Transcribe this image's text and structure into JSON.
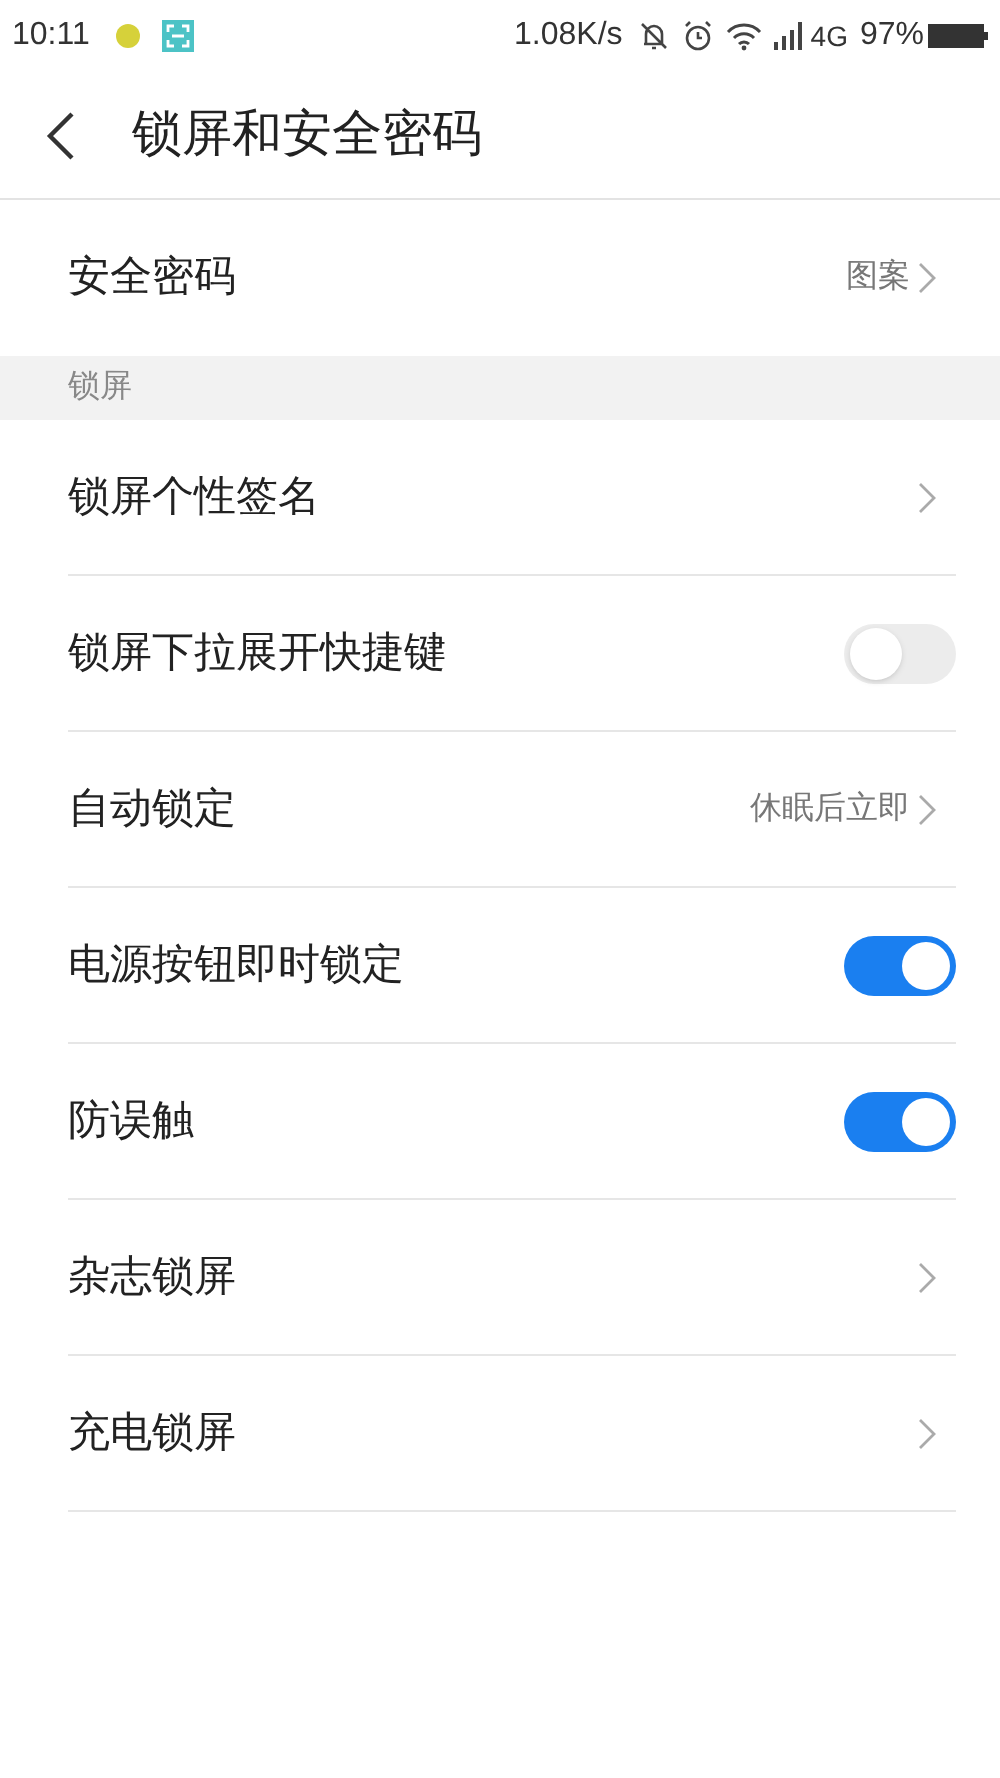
{
  "status_bar": {
    "time": "10:11",
    "speed": "1.08K/s",
    "network": "4G",
    "battery": "97%"
  },
  "header": {
    "title": "锁屏和安全密码"
  },
  "sections": [
    {
      "rows": [
        {
          "kind": "link",
          "label": "安全密码",
          "value": "图案"
        }
      ]
    },
    {
      "title": "锁屏",
      "rows": [
        {
          "kind": "link",
          "label": "锁屏个性签名"
        },
        {
          "kind": "switch",
          "label": "锁屏下拉展开快捷键",
          "on": false
        },
        {
          "kind": "link",
          "label": "自动锁定",
          "value": "休眠后立即"
        },
        {
          "kind": "switch",
          "label": "电源按钮即时锁定",
          "on": true
        },
        {
          "kind": "switch",
          "label": "防误触",
          "on": true
        },
        {
          "kind": "link",
          "label": "杂志锁屏"
        },
        {
          "kind": "link",
          "label": "充电锁屏"
        }
      ]
    }
  ]
}
